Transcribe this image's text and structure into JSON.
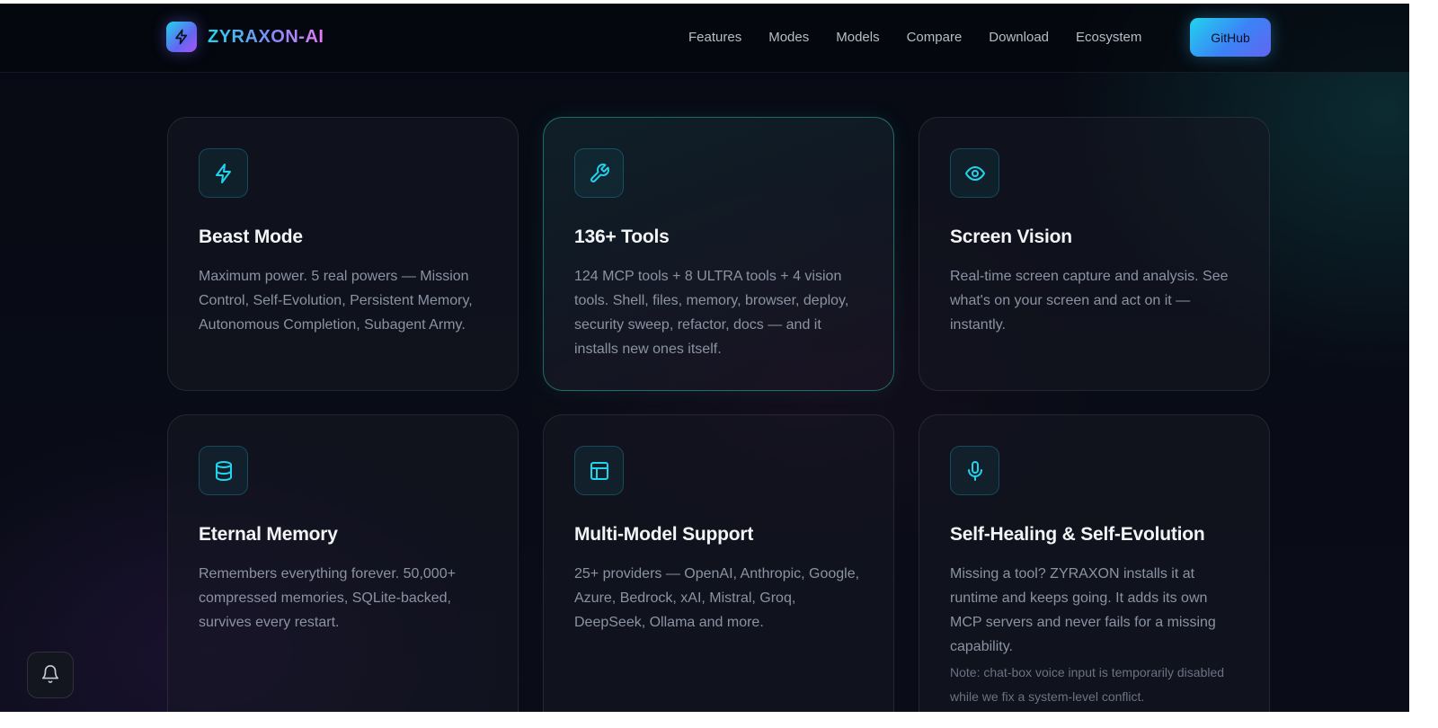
{
  "brand": {
    "name": "ZYRAXON-AI",
    "logo_icon": "bolt-icon"
  },
  "nav": {
    "links": [
      "Features",
      "Modes",
      "Models",
      "Compare",
      "Download",
      "Ecosystem"
    ],
    "github_label": "GitHub"
  },
  "colors": {
    "accent": "#22d3ee",
    "accent_secondary": "#6366f1",
    "background": "#070a13"
  },
  "features": [
    {
      "icon": "bolt-icon",
      "title": "Beast Mode",
      "description": "Maximum power. 5 real powers — Mission Control, Self-Evolution, Persistent Memory, Autonomous Completion, Subagent Army."
    },
    {
      "icon": "wrench-icon",
      "title": "136+ Tools",
      "description": "124 MCP tools + 8 ULTRA tools + 4 vision tools. Shell, files, memory, browser, deploy, security sweep, refactor, docs — and it installs new ones itself."
    },
    {
      "icon": "eye-icon",
      "title": "Screen Vision",
      "description": "Real-time screen capture and analysis. See what's on your screen and act on it — instantly."
    },
    {
      "icon": "database-icon",
      "title": "Eternal Memory",
      "description": "Remembers everything forever. 50,000+ compressed memories, SQLite-backed, survives every restart."
    },
    {
      "icon": "layout-icon",
      "title": "Multi-Model Support",
      "description": "25+ providers — OpenAI, Anthropic, Google, Azure, Bedrock, xAI, Mistral, Groq, DeepSeek, Ollama and more."
    },
    {
      "icon": "microphone-icon",
      "title": "Self-Healing & Self-Evolution",
      "description": "Missing a tool? ZYRAXON installs it at runtime and keeps going. It adds its own MCP servers and never fails for a missing capability.",
      "note": "Note: chat-box voice input is temporarily disabled while we fix a system-level conflict."
    }
  ],
  "notification_button": {
    "icon": "bell-icon"
  }
}
